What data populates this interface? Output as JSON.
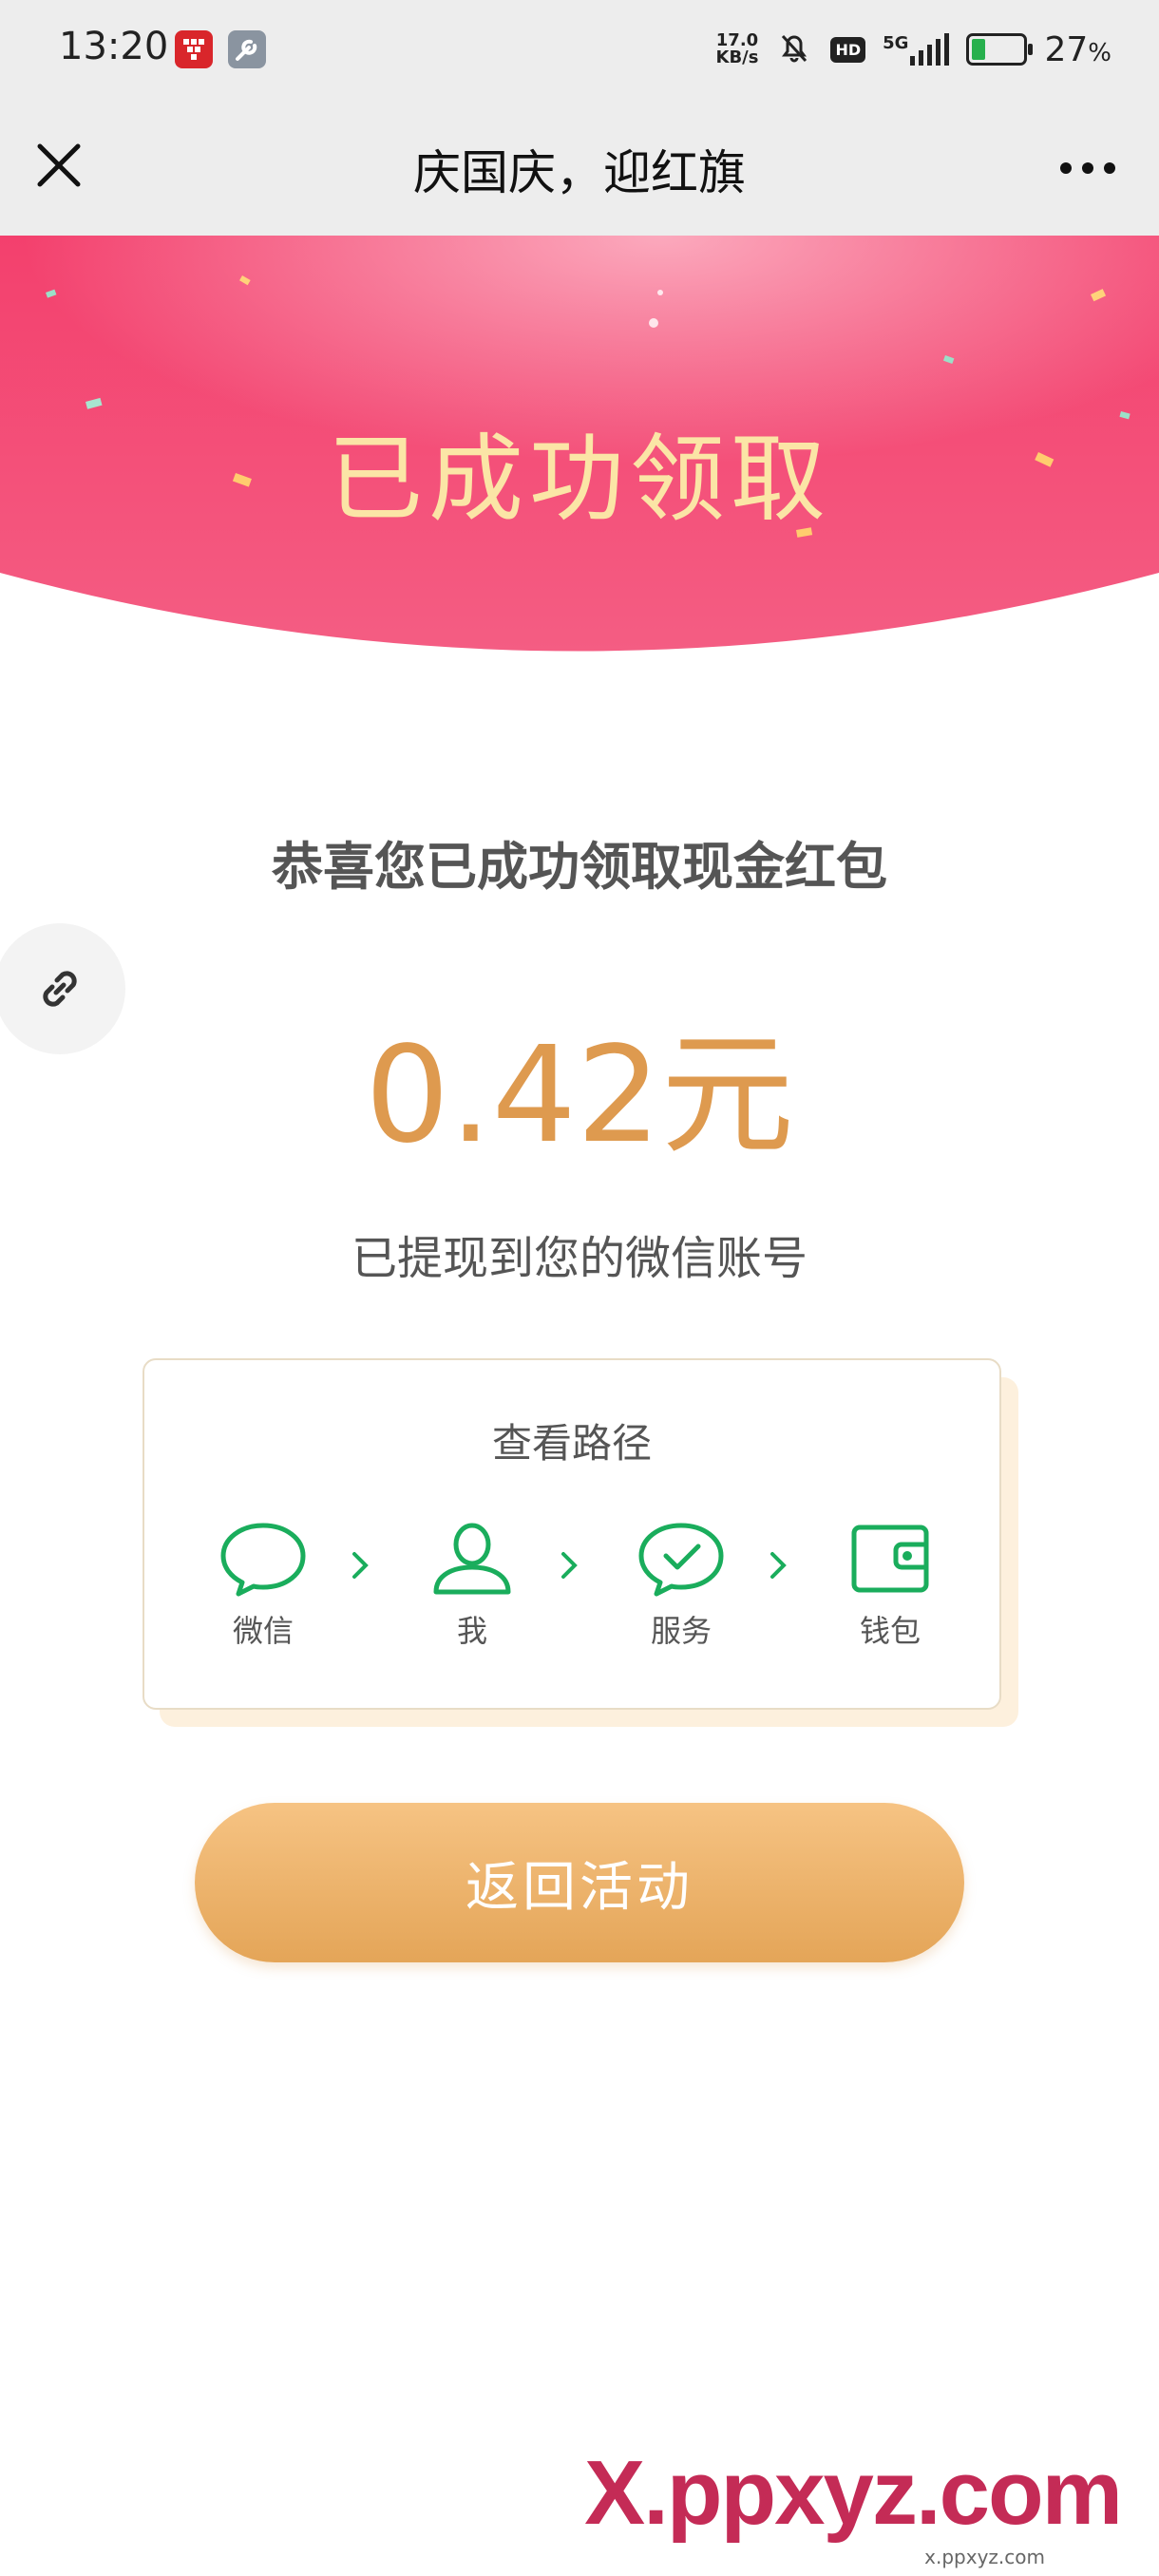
{
  "status_bar": {
    "time": "13:20",
    "net_speed_value": "17.0",
    "net_speed_unit": "KB/s",
    "hd_badge": "HD",
    "network": "5G",
    "battery_percent": "27",
    "battery_unit": "%",
    "battery_level": 0.27
  },
  "nav": {
    "title": "庆国庆，迎红旗"
  },
  "banner": {
    "title": "已成功领取"
  },
  "content": {
    "congrats": "恭喜您已成功领取现金红包",
    "amount": "0.42元",
    "withdraw_note": "已提现到您的微信账号"
  },
  "path_card": {
    "title": "查看路径",
    "steps": [
      {
        "label": "微信",
        "icon": "chat-bubble-icon"
      },
      {
        "label": "我",
        "icon": "person-icon"
      },
      {
        "label": "服务",
        "icon": "check-bubble-icon"
      },
      {
        "label": "钱包",
        "icon": "wallet-icon"
      }
    ]
  },
  "return_button": {
    "label": "返回活动"
  },
  "watermark": {
    "text": "X.ppxyz.com",
    "small": "x.ppxyz.com"
  },
  "colors": {
    "banner_pink": "#f24f78",
    "banner_text": "#fbe5a6",
    "amount": "#de9a4f",
    "wechat_green": "#1aad5c",
    "button_gold": "#e9ac62"
  }
}
